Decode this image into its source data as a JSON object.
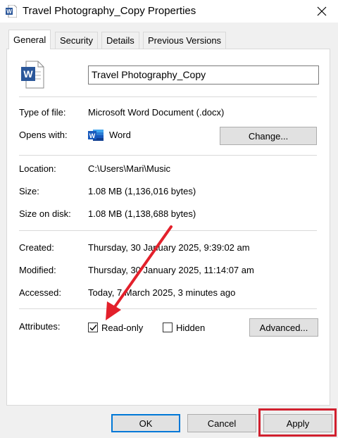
{
  "window": {
    "title": "Travel Photography_Copy Properties",
    "app_icon": "word-document-icon"
  },
  "tabs": [
    {
      "label": "General",
      "active": true
    },
    {
      "label": "Security",
      "active": false
    },
    {
      "label": "Details",
      "active": false
    },
    {
      "label": "Previous Versions",
      "active": false
    }
  ],
  "general": {
    "file_icon": "word-document-icon",
    "filename": "Travel Photography_Copy",
    "type_label": "Type of file:",
    "type_value": "Microsoft Word Document (.docx)",
    "opens_label": "Opens with:",
    "opens_app": "Word",
    "opens_icon": "word-app-icon",
    "change_button": "Change...",
    "location_label": "Location:",
    "location_value": "C:\\Users\\Mari\\Music",
    "size_label": "Size:",
    "size_value": "1.08 MB (1,136,016 bytes)",
    "size_disk_label": "Size on disk:",
    "size_disk_value": "1.08 MB (1,138,688 bytes)",
    "created_label": "Created:",
    "created_value": "Thursday, 30 January 2025, 9:39:02 am",
    "modified_label": "Modified:",
    "modified_value": "Thursday, 30 January 2025, 11:14:07 am",
    "accessed_label": "Accessed:",
    "accessed_value": "Today, 7 March 2025, 3 minutes ago",
    "attributes_label": "Attributes:",
    "readonly_label": "Read-only",
    "readonly_checked": true,
    "hidden_label": "Hidden",
    "hidden_checked": false,
    "advanced_button": "Advanced..."
  },
  "footer": {
    "ok": "OK",
    "cancel": "Cancel",
    "apply": "Apply"
  },
  "annotations": {
    "arrow_color": "#e3202b",
    "highlight_color": "#d1202e"
  },
  "colors": {
    "word_blue": "#2b579a",
    "focus_blue": "#0078d7"
  }
}
